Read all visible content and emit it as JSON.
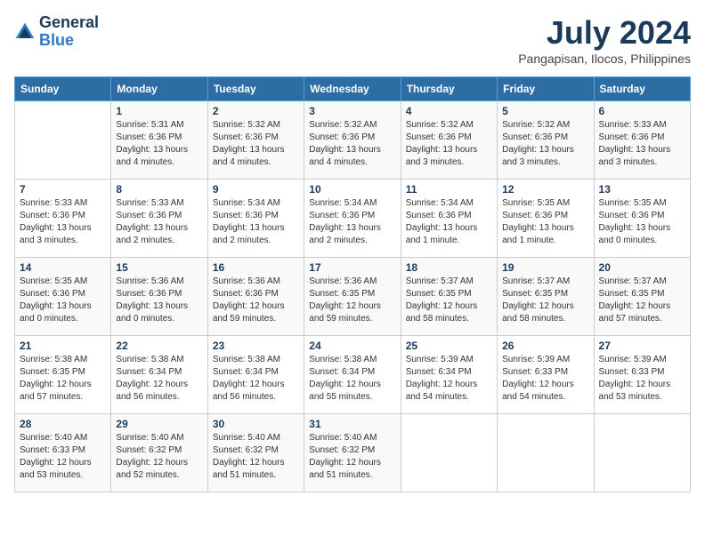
{
  "header": {
    "logo_line1": "General",
    "logo_line2": "Blue",
    "month": "July 2024",
    "location": "Pangapisan, Ilocos, Philippines"
  },
  "weekdays": [
    "Sunday",
    "Monday",
    "Tuesday",
    "Wednesday",
    "Thursday",
    "Friday",
    "Saturday"
  ],
  "weeks": [
    [
      {
        "day": "",
        "info": ""
      },
      {
        "day": "1",
        "info": "Sunrise: 5:31 AM\nSunset: 6:36 PM\nDaylight: 13 hours\nand 4 minutes."
      },
      {
        "day": "2",
        "info": "Sunrise: 5:32 AM\nSunset: 6:36 PM\nDaylight: 13 hours\nand 4 minutes."
      },
      {
        "day": "3",
        "info": "Sunrise: 5:32 AM\nSunset: 6:36 PM\nDaylight: 13 hours\nand 4 minutes."
      },
      {
        "day": "4",
        "info": "Sunrise: 5:32 AM\nSunset: 6:36 PM\nDaylight: 13 hours\nand 3 minutes."
      },
      {
        "day": "5",
        "info": "Sunrise: 5:32 AM\nSunset: 6:36 PM\nDaylight: 13 hours\nand 3 minutes."
      },
      {
        "day": "6",
        "info": "Sunrise: 5:33 AM\nSunset: 6:36 PM\nDaylight: 13 hours\nand 3 minutes."
      }
    ],
    [
      {
        "day": "7",
        "info": "Sunrise: 5:33 AM\nSunset: 6:36 PM\nDaylight: 13 hours\nand 3 minutes."
      },
      {
        "day": "8",
        "info": "Sunrise: 5:33 AM\nSunset: 6:36 PM\nDaylight: 13 hours\nand 2 minutes."
      },
      {
        "day": "9",
        "info": "Sunrise: 5:34 AM\nSunset: 6:36 PM\nDaylight: 13 hours\nand 2 minutes."
      },
      {
        "day": "10",
        "info": "Sunrise: 5:34 AM\nSunset: 6:36 PM\nDaylight: 13 hours\nand 2 minutes."
      },
      {
        "day": "11",
        "info": "Sunrise: 5:34 AM\nSunset: 6:36 PM\nDaylight: 13 hours\nand 1 minute."
      },
      {
        "day": "12",
        "info": "Sunrise: 5:35 AM\nSunset: 6:36 PM\nDaylight: 13 hours\nand 1 minute."
      },
      {
        "day": "13",
        "info": "Sunrise: 5:35 AM\nSunset: 6:36 PM\nDaylight: 13 hours\nand 0 minutes."
      }
    ],
    [
      {
        "day": "14",
        "info": "Sunrise: 5:35 AM\nSunset: 6:36 PM\nDaylight: 13 hours\nand 0 minutes."
      },
      {
        "day": "15",
        "info": "Sunrise: 5:36 AM\nSunset: 6:36 PM\nDaylight: 13 hours\nand 0 minutes."
      },
      {
        "day": "16",
        "info": "Sunrise: 5:36 AM\nSunset: 6:36 PM\nDaylight: 12 hours\nand 59 minutes."
      },
      {
        "day": "17",
        "info": "Sunrise: 5:36 AM\nSunset: 6:35 PM\nDaylight: 12 hours\nand 59 minutes."
      },
      {
        "day": "18",
        "info": "Sunrise: 5:37 AM\nSunset: 6:35 PM\nDaylight: 12 hours\nand 58 minutes."
      },
      {
        "day": "19",
        "info": "Sunrise: 5:37 AM\nSunset: 6:35 PM\nDaylight: 12 hours\nand 58 minutes."
      },
      {
        "day": "20",
        "info": "Sunrise: 5:37 AM\nSunset: 6:35 PM\nDaylight: 12 hours\nand 57 minutes."
      }
    ],
    [
      {
        "day": "21",
        "info": "Sunrise: 5:38 AM\nSunset: 6:35 PM\nDaylight: 12 hours\nand 57 minutes."
      },
      {
        "day": "22",
        "info": "Sunrise: 5:38 AM\nSunset: 6:34 PM\nDaylight: 12 hours\nand 56 minutes."
      },
      {
        "day": "23",
        "info": "Sunrise: 5:38 AM\nSunset: 6:34 PM\nDaylight: 12 hours\nand 56 minutes."
      },
      {
        "day": "24",
        "info": "Sunrise: 5:38 AM\nSunset: 6:34 PM\nDaylight: 12 hours\nand 55 minutes."
      },
      {
        "day": "25",
        "info": "Sunrise: 5:39 AM\nSunset: 6:34 PM\nDaylight: 12 hours\nand 54 minutes."
      },
      {
        "day": "26",
        "info": "Sunrise: 5:39 AM\nSunset: 6:33 PM\nDaylight: 12 hours\nand 54 minutes."
      },
      {
        "day": "27",
        "info": "Sunrise: 5:39 AM\nSunset: 6:33 PM\nDaylight: 12 hours\nand 53 minutes."
      }
    ],
    [
      {
        "day": "28",
        "info": "Sunrise: 5:40 AM\nSunset: 6:33 PM\nDaylight: 12 hours\nand 53 minutes."
      },
      {
        "day": "29",
        "info": "Sunrise: 5:40 AM\nSunset: 6:32 PM\nDaylight: 12 hours\nand 52 minutes."
      },
      {
        "day": "30",
        "info": "Sunrise: 5:40 AM\nSunset: 6:32 PM\nDaylight: 12 hours\nand 51 minutes."
      },
      {
        "day": "31",
        "info": "Sunrise: 5:40 AM\nSunset: 6:32 PM\nDaylight: 12 hours\nand 51 minutes."
      },
      {
        "day": "",
        "info": ""
      },
      {
        "day": "",
        "info": ""
      },
      {
        "day": "",
        "info": ""
      }
    ]
  ]
}
